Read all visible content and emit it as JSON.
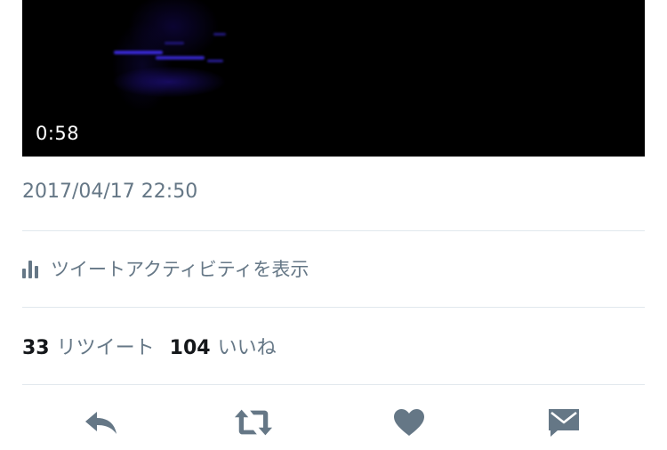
{
  "video": {
    "duration": "0:58"
  },
  "tweet": {
    "timestamp": "2017/04/17 22:50",
    "activity_label": "ツイートアクティビティを表示",
    "retweet_count": "33",
    "retweet_label": "リツイート",
    "like_count": "104",
    "like_label": "いいね"
  },
  "actions": {
    "reply_icon": "reply-icon",
    "retweet_icon": "retweet-icon",
    "like_icon": "heart-icon",
    "dm_icon": "envelope-icon"
  },
  "colors": {
    "secondary_text": "#657786",
    "primary_text": "#14171a",
    "divider": "#e1e8ed",
    "video_bg": "#000000"
  }
}
